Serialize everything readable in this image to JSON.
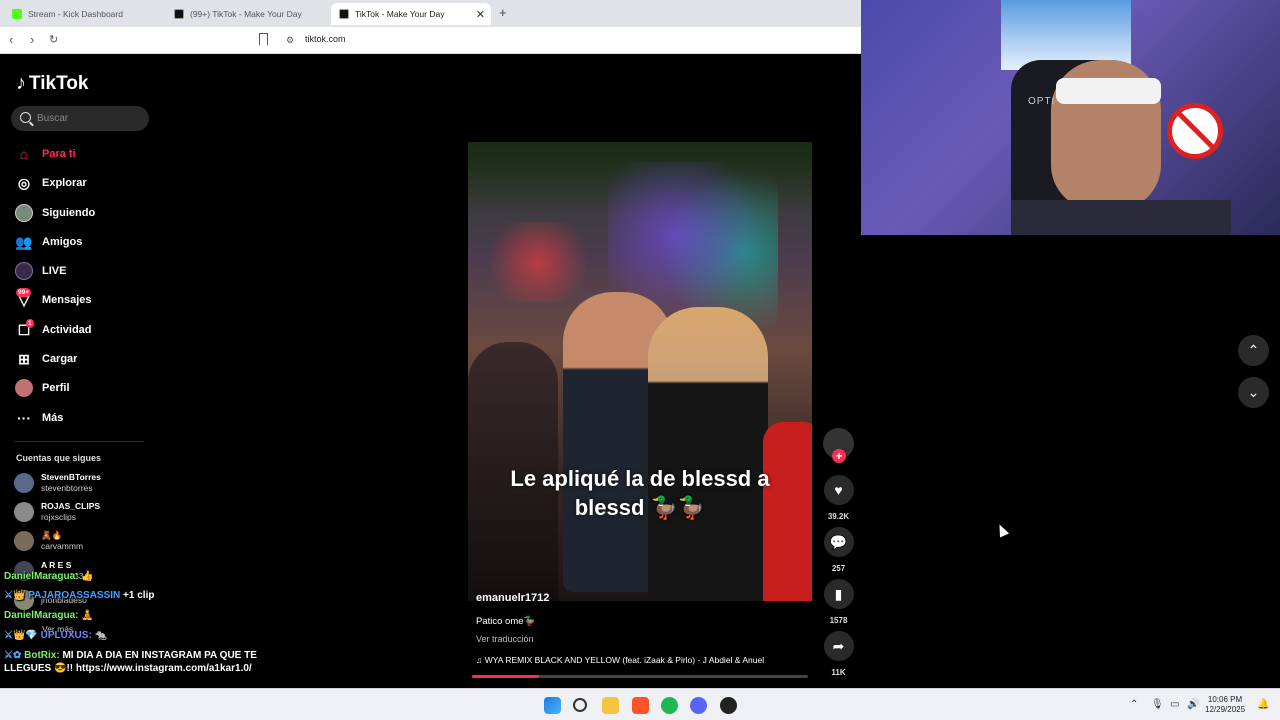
{
  "browser": {
    "tabs": [
      {
        "label": "Stream - Kick Dashboard",
        "active": false,
        "favicon_color": "#53fc18"
      },
      {
        "label": "(99+) TikTok - Make Your Day",
        "active": false,
        "favicon_color": "#000000"
      },
      {
        "label": "TikTok - Make Your Day",
        "active": true,
        "favicon_color": "#000000"
      }
    ],
    "url": "tiktok.com"
  },
  "sidebar": {
    "logo": "TikTok",
    "search_placeholder": "Buscar",
    "nav": [
      {
        "label": "Para ti",
        "icon": "home-icon",
        "active": true
      },
      {
        "label": "Explorar",
        "icon": "compass-icon"
      },
      {
        "label": "Siguiendo",
        "icon": "following-avatar-icon"
      },
      {
        "label": "Amigos",
        "icon": "friends-icon"
      },
      {
        "label": "LIVE",
        "icon": "live-icon"
      },
      {
        "label": "Mensajes",
        "icon": "messages-icon",
        "badge": "99+"
      },
      {
        "label": "Actividad",
        "icon": "activity-icon",
        "badge": "1"
      },
      {
        "label": "Cargar",
        "icon": "upload-icon"
      },
      {
        "label": "Perfil",
        "icon": "profile-icon"
      },
      {
        "label": "Más",
        "icon": "more-icon"
      }
    ],
    "following_title": "Cuentas que sigues",
    "following": [
      {
        "name": "StevenBTorres",
        "handle": "stevenbtorres"
      },
      {
        "name": "ROJAS_CLIPS",
        "handle": "rojxsclips"
      },
      {
        "name": "🧸🔥",
        "handle": "carvammm"
      },
      {
        "name": "A R E S",
        "handle": "ares_...333"
      },
      {
        "name": "",
        "handle": "jhonblades0"
      }
    ],
    "see_more": "Ver más"
  },
  "chat": [
    {
      "user": "DanielMaragua:",
      "message": " 👍"
    },
    {
      "user": "PAJAROASSASSIN",
      "message": " +1 clip"
    },
    {
      "user": "DanielMaragua:",
      "message": " 🧘"
    },
    {
      "user": "UPLUXUS:",
      "message": " 🐀"
    },
    {
      "user": "BotRix:",
      "message": " MI DIA A DIA EN INSTAGRAM PA QUE TE LLEGUES 😎!! https://www.instagram.com/a1kar1.0/"
    }
  ],
  "video": {
    "overlay_text_line1": "Le apliqué la de blessd a",
    "overlay_text_line2": "blessd 🦆🦆",
    "author": "emanuelr1712",
    "description": "Patico ome🦆",
    "translate": "Ver traducción",
    "music": "WYA REMIX BLACK AND YELLOW (feat. iZaak & Pirlo) - J Abdiel & Anuel",
    "progress": 0.2
  },
  "actions": {
    "likes": "39.2K",
    "comments": "257",
    "saves": "1578",
    "shares": "11K"
  },
  "webcam": {
    "brand_text": "OPTI"
  },
  "taskbar": {
    "time": "10:06 PM",
    "date": "12/29/2025"
  }
}
